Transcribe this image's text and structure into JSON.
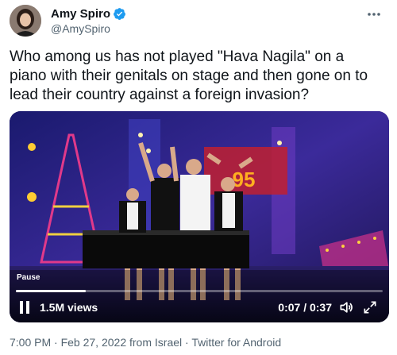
{
  "author": {
    "display_name": "Amy Spiro",
    "handle": "@AmySpiro",
    "verified": true,
    "avatar_icon": "user-avatar"
  },
  "more_icon": "more-horizontal-icon",
  "tweet": {
    "text": "Who among us has not played \"Hava Nagila\" on a piano with their genitals on stage and then gone on to lead their country against a foreign invasion?"
  },
  "video": {
    "pause_tooltip": "Pause",
    "views": "1.5M views",
    "time": "0:07 / 0:37",
    "progress": 0.19,
    "stage_sign": "95",
    "icons": [
      "pause-icon",
      "volume-icon",
      "fullscreen-icon"
    ]
  },
  "meta": {
    "time": "7:00 PM",
    "date": "Feb 27, 2022",
    "location": "from Israel",
    "client": "Twitter for Android",
    "separator": "·"
  },
  "colors": {
    "text_primary": "#0f1419",
    "text_secondary": "#536471",
    "verified_blue": "#1d9bf0"
  }
}
